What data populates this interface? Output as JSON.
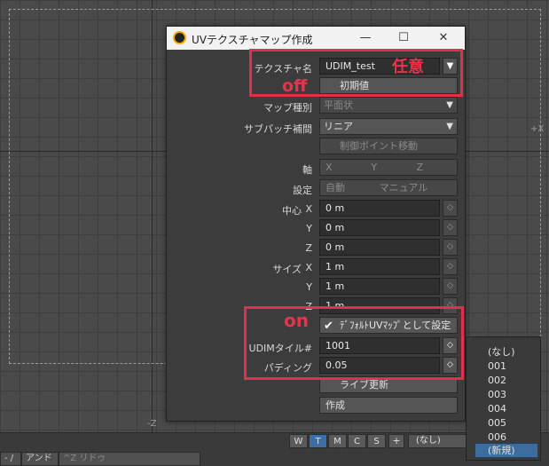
{
  "viewport": {
    "axis_plus_x": "+X",
    "axis_minus_z": "-Z"
  },
  "dialog": {
    "title": "UVテクスチャマップ作成",
    "window_buttons": {
      "minimize": "—",
      "maximize": "☐",
      "close": "✕"
    },
    "texture_name": {
      "label": "テクスチャ名",
      "value": "UDIM_test"
    },
    "initial_value_button": "初期値",
    "map_type": {
      "label": "マップ種別",
      "value": "平面状"
    },
    "subpatch_interp": {
      "label": "サブパッチ補間",
      "value": "リニア"
    },
    "control_point_move_button": "制御ポイント移動",
    "axis": {
      "label": "軸",
      "options": [
        "X",
        "Y",
        "Z"
      ]
    },
    "settings": {
      "label": "設定",
      "options": [
        "自動",
        "マニュアル"
      ]
    },
    "center": {
      "label": "中心",
      "rows": [
        {
          "axis": "X",
          "value": "0 m"
        },
        {
          "axis": "Y",
          "value": "0 m"
        },
        {
          "axis": "Z",
          "value": "0 m"
        }
      ]
    },
    "size": {
      "label": "サイズ",
      "rows": [
        {
          "axis": "X",
          "value": "1 m"
        },
        {
          "axis": "Y",
          "value": "1 m"
        },
        {
          "axis": "Z",
          "value": "1 m"
        }
      ]
    },
    "default_uv_checkbox": {
      "label": "ﾃﾞﾌｫﾙﾄUVﾏｯﾌﾟとして設定",
      "checked": true
    },
    "udim_tile": {
      "label": "UDIMタイル#",
      "value": "1001"
    },
    "padding": {
      "label": "パディング",
      "value": "0.05"
    },
    "live_update_button": "ライブ更新",
    "create_button": "作成"
  },
  "annotations": {
    "arbitrary": "任意",
    "off": "off",
    "on": "on",
    "color": "#e0304a"
  },
  "bottom_bar": {
    "view_buttons": [
      "W",
      "T",
      "M",
      "C",
      "S"
    ],
    "active_view": "T",
    "plus": "+",
    "uv_select": "(なし)",
    "left_cell": "- /",
    "undo": "アンドゥ",
    "redo": "^Z リドゥ"
  },
  "uv_popup": {
    "items": [
      "(なし)",
      "001",
      "002",
      "003",
      "004",
      "005",
      "006",
      "(新規)"
    ],
    "selected": "(新規)"
  }
}
